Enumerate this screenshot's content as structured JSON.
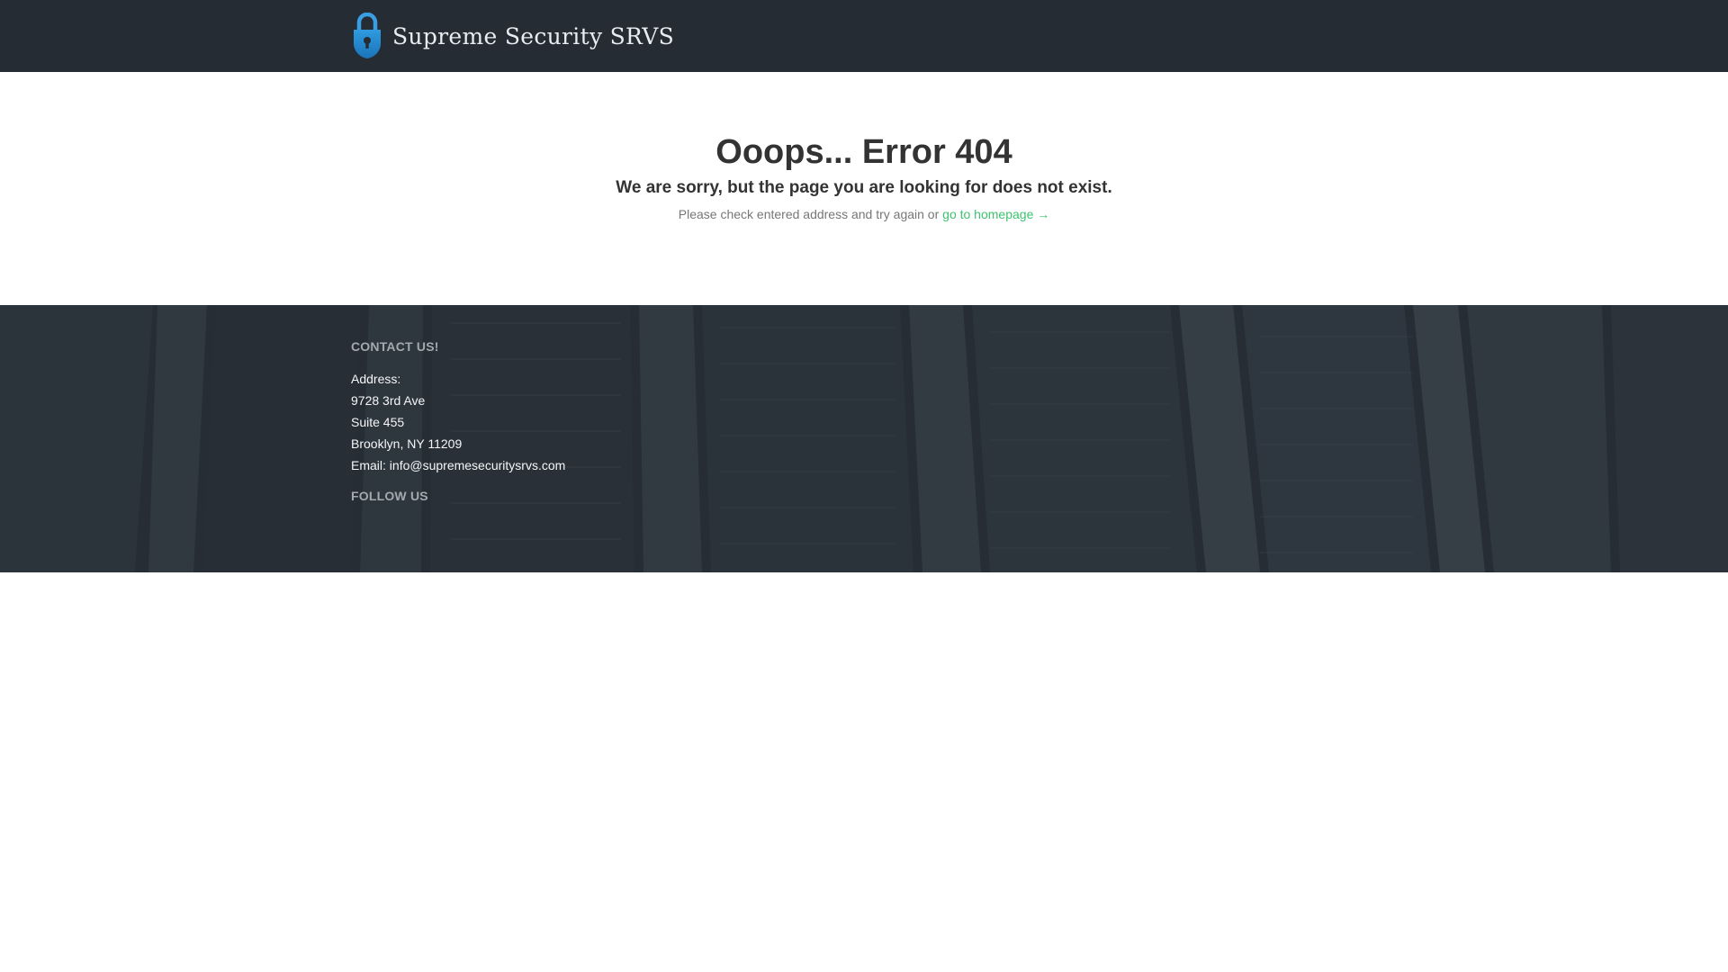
{
  "header": {
    "brand_name": "Supreme Security SRVS",
    "brand_icon": "padlock-icon",
    "background_color": "#262c33"
  },
  "error": {
    "title": "Ooops... Error 404",
    "subtitle": "We are sorry, but the page you are looking for does not exist.",
    "hint_text": "Please check entered address and try again or ",
    "homepage_link": "go to homepage →",
    "link_color": "#3ec36f"
  },
  "footer": {
    "contact_heading": "CONTACT US!",
    "address_label": "Address:",
    "address_line1": "9728 3rd Ave",
    "address_line2": "Suite 455",
    "address_line3": "Brooklyn, NY 11209",
    "email_label": "Email: ",
    "email": "info@supremesecuritysrvs.com",
    "follow_heading": "FOLLOW US",
    "background": "server-racks-photo"
  }
}
